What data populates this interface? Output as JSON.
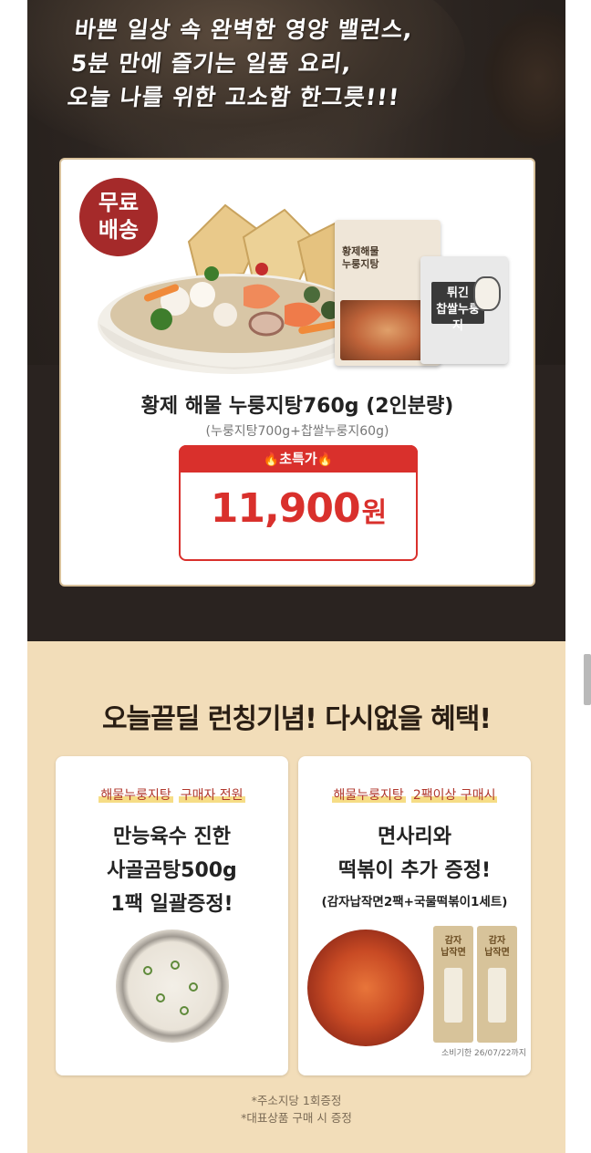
{
  "hero": {
    "headline_lines": [
      "바쁜 일상 속 완벽한 영양 밸런스,",
      "5분 만에 즐기는 일품 요리,",
      "오늘 나를 위한 고소함 한그릇!!!"
    ],
    "badge_lines": [
      "무료",
      "배송"
    ],
    "package1_label": "황제해물\n누룽지탕",
    "package2_label": "튀긴\n찹쌀누룽지",
    "product_name": "황제 해물 누룽지탕760g (2인분량)",
    "product_sub": "(누룽지탕700g+찹쌀누룽지60g)",
    "price_tag": "초특가",
    "price": "11,900",
    "price_unit": "원"
  },
  "promo": {
    "title": "오늘끝딜 런칭기념! 다시없을 혜택!",
    "left": {
      "highlight_a": "해물누룽지탕",
      "highlight_b": "구매자 전원",
      "lines": [
        "만능육수 진한",
        "사골곰탕500g",
        "1팩 일괄증정!"
      ]
    },
    "right": {
      "highlight_a": "해물누룽지탕",
      "highlight_b": "2팩이상 구매시",
      "lines": [
        "면사리와",
        "떡볶이 추가 증정!"
      ],
      "sub": "(감자납작면2팩+국물떡볶이1세트)",
      "pack_label": "감자\n납작면",
      "expire": "소비기한 26/07/22까지"
    },
    "notes": [
      "*주소지당 1회증정",
      "*대표상품 구매 시 증정"
    ]
  },
  "colors": {
    "hero_bg": "#2a2320",
    "price_red": "#d9302c",
    "badge_red": "#a52a2a",
    "promo_bg": "#f2ddb9",
    "highlight_red": "#b0372c"
  }
}
